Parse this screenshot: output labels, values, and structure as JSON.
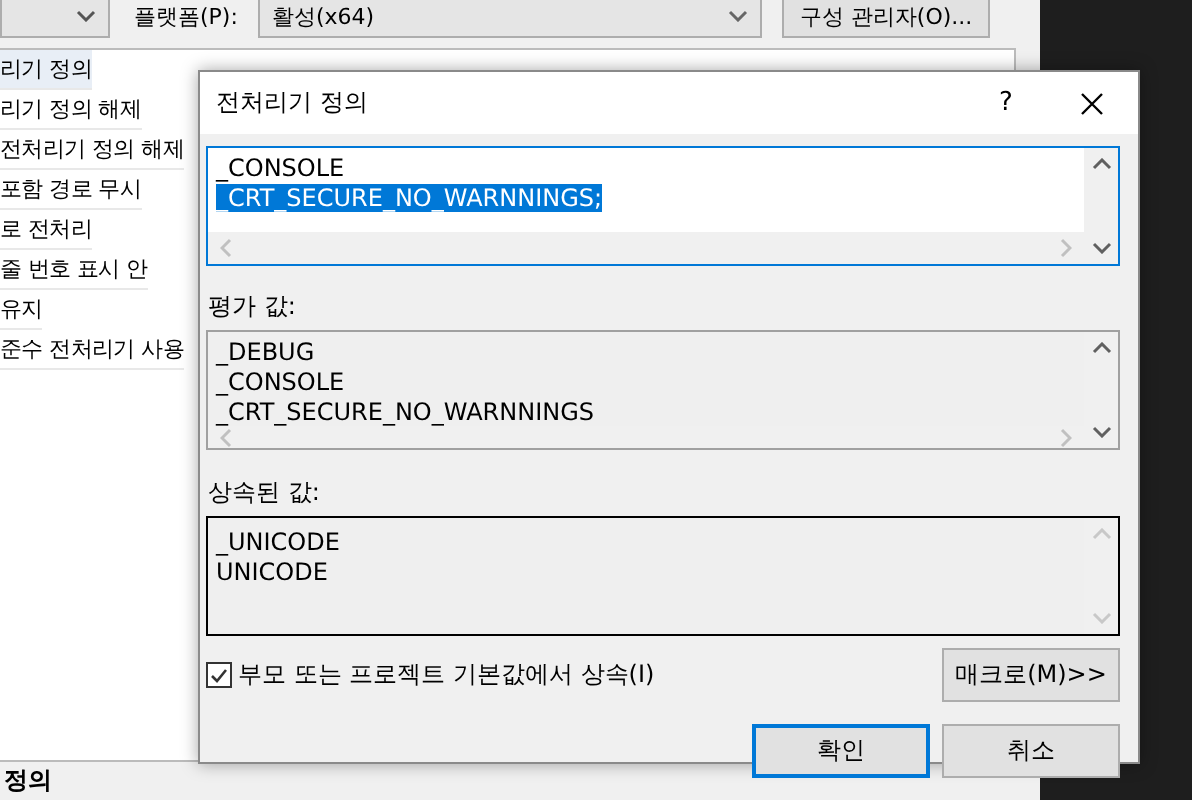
{
  "background": {
    "platform_label": "플랫폼(P):",
    "platform_value": "활성(x64)",
    "config_button": "구성 관리자(O)...",
    "properties": [
      {
        "name": "리기 정의",
        "selected": true
      },
      {
        "name": "리기 정의 해제",
        "selected": false
      },
      {
        "name": "전처리기 정의 해제",
        "selected": false
      },
      {
        "name": "포함 경로 무시",
        "selected": false
      },
      {
        "name": "로 전처리",
        "selected": false
      },
      {
        "name": "줄 번호 표시 안",
        "selected": false
      },
      {
        "name": "유지",
        "selected": false
      },
      {
        "name": "준수 전처리기 사용",
        "selected": false
      }
    ],
    "footer": "정의"
  },
  "dialog": {
    "title": "전처리기 정의",
    "help": "?",
    "definitions": [
      {
        "text": "_CONSOLE",
        "selected": false
      },
      {
        "text": "_CRT_SECURE_NO_WARNNINGS;",
        "selected": true
      }
    ],
    "evaluated_label": "평가 값:",
    "evaluated": [
      "_DEBUG",
      "_CONSOLE",
      "_CRT_SECURE_NO_WARNNINGS"
    ],
    "inherited_label": "상속된 값:",
    "inherited": [
      "_UNICODE",
      "UNICODE"
    ],
    "inherit_checkbox": {
      "label": "부모 또는 프로젝트 기본값에서 상속(I)",
      "checked": true
    },
    "buttons": [
      {
        "label": "매크로(M)>>",
        "kind": "macro"
      },
      {
        "label": "확인",
        "kind": "default"
      },
      {
        "label": "취소",
        "kind": "normal"
      }
    ]
  }
}
